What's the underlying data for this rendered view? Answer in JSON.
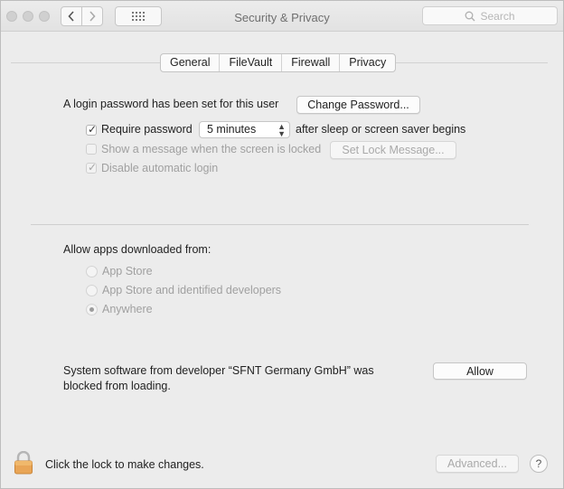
{
  "window": {
    "title": "Security & Privacy",
    "search_placeholder": "Search"
  },
  "tabs": [
    {
      "label": "General",
      "selected": true
    },
    {
      "label": "FileVault",
      "selected": false
    },
    {
      "label": "Firewall",
      "selected": false
    },
    {
      "label": "Privacy",
      "selected": false
    }
  ],
  "general": {
    "login_password_text": "A login password has been set for this user",
    "change_password_label": "Change Password...",
    "require_password": {
      "label": "Require password",
      "checked": true,
      "enabled": true
    },
    "require_password_delay": "5 minutes",
    "after_sleep_text": "after sleep or screen saver begins",
    "show_message": {
      "label": "Show a message when the screen is locked",
      "checked": false,
      "enabled": false
    },
    "set_lock_message_label": "Set Lock Message...",
    "disable_auto_login": {
      "label": "Disable automatic login",
      "checked": true,
      "enabled": false
    }
  },
  "allow_apps": {
    "heading": "Allow apps downloaded from:",
    "options": [
      {
        "label": "App Store",
        "selected": false
      },
      {
        "label": "App Store and identified developers",
        "selected": false
      },
      {
        "label": "Anywhere",
        "selected": true
      }
    ]
  },
  "blocked": {
    "line1": "System software from developer “SFNT Germany GmbH” was",
    "line2": "blocked from loading.",
    "allow_label": "Allow"
  },
  "footer": {
    "lock_text": "Click the lock to make changes.",
    "advanced_label": "Advanced...",
    "help_label": "?"
  }
}
